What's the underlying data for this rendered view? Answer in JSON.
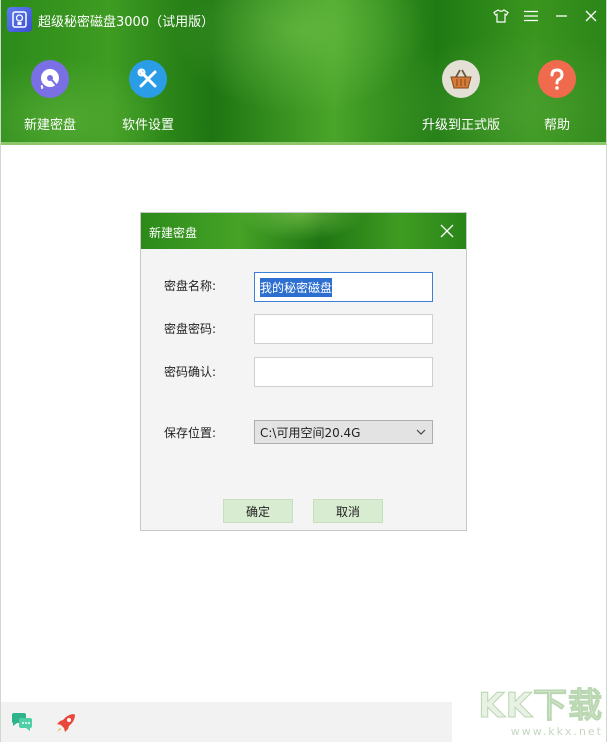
{
  "app": {
    "title": "超级秘密磁盘3000（试用版）"
  },
  "toolbar": {
    "items": [
      {
        "label": "新建密盘",
        "icon": "new-disk-icon",
        "color": "#7b6fe6"
      },
      {
        "label": "软件设置",
        "icon": "tools-icon",
        "color": "#2b9de6"
      },
      {
        "label": "升级到正式版",
        "icon": "basket-icon",
        "color": "#e4e0d6"
      },
      {
        "label": "帮助",
        "icon": "help-icon",
        "color": "#f06a4e"
      }
    ]
  },
  "dialog": {
    "title": "新建密盘",
    "name_label": "密盘名称:",
    "name_value": "我的秘密磁盘",
    "password_label": "密盘密码:",
    "password_value": "",
    "confirm_label": "密码确认:",
    "confirm_value": "",
    "location_label": "保存位置:",
    "location_value": "C:\\可用空间20.4G",
    "ok_label": "确定",
    "cancel_label": "取消"
  },
  "footer": {
    "icons": [
      "chat-icon",
      "rocket-icon"
    ]
  },
  "watermark": {
    "brand": "KK下载",
    "url": "www.kkx.net"
  },
  "colors": {
    "header_green": "#2c8a1a",
    "accent_blue": "#2d6fd0",
    "button_bg": "#d8ecd1"
  }
}
